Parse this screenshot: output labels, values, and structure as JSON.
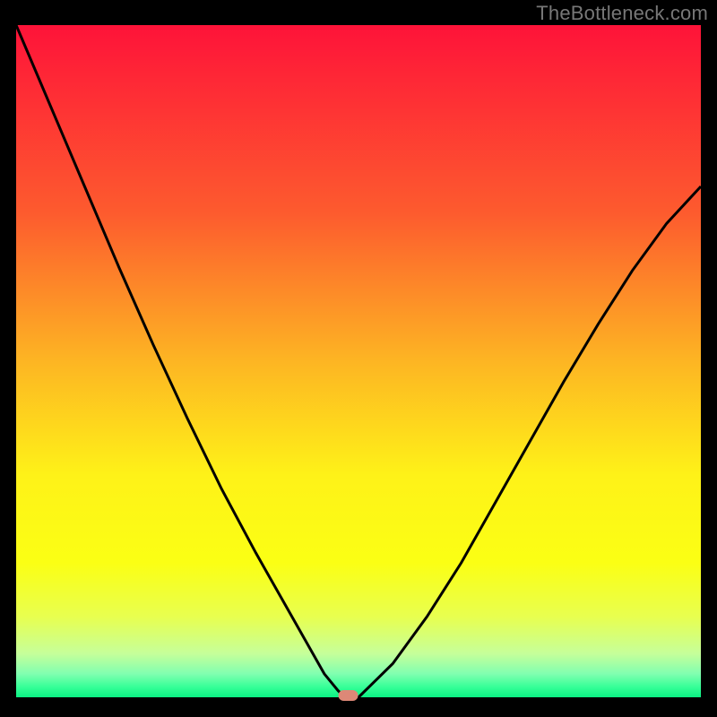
{
  "watermark": "TheBottleneck.com",
  "chart_data": {
    "type": "line",
    "title": "",
    "xlabel": "",
    "ylabel": "",
    "xlim": [
      0,
      100
    ],
    "ylim": [
      0,
      100
    ],
    "series": [
      {
        "name": "bottleneck-curve",
        "x": [
          0,
          5,
          10,
          15,
          20,
          25,
          30,
          35,
          40,
          42.5,
          45,
          47,
          48,
          50,
          55,
          60,
          65,
          70,
          75,
          80,
          85,
          90,
          95,
          100
        ],
        "y": [
          100,
          88,
          76,
          64,
          52.5,
          41.5,
          31,
          21.5,
          12.5,
          8,
          3.5,
          1,
          0,
          0,
          5,
          12,
          20,
          29,
          38,
          47,
          55.5,
          63.5,
          70.5,
          76
        ]
      }
    ],
    "marker": {
      "name": "optimal-point",
      "x": 48.5,
      "y": 0,
      "color": "#dd8877"
    },
    "gradient_stops": [
      {
        "offset": 0,
        "color": "#fe1339"
      },
      {
        "offset": 0.28,
        "color": "#fd5b2e"
      },
      {
        "offset": 0.5,
        "color": "#fdb523"
      },
      {
        "offset": 0.67,
        "color": "#fef218"
      },
      {
        "offset": 0.8,
        "color": "#fbff14"
      },
      {
        "offset": 0.88,
        "color": "#e8ff4f"
      },
      {
        "offset": 0.935,
        "color": "#c6ff9a"
      },
      {
        "offset": 0.965,
        "color": "#81ffb0"
      },
      {
        "offset": 0.985,
        "color": "#35ff97"
      },
      {
        "offset": 1.0,
        "color": "#0bf183"
      }
    ]
  }
}
